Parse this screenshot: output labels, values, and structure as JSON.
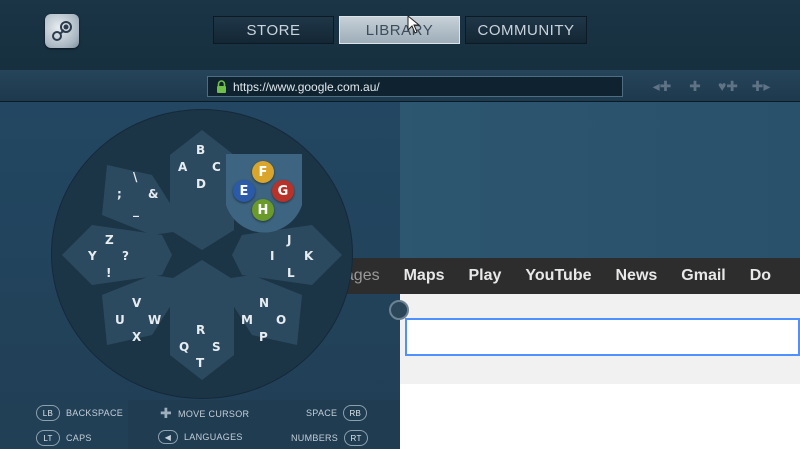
{
  "nav": {
    "tabs": [
      {
        "label": "STORE"
      },
      {
        "label": "LIBRARY",
        "active": true
      },
      {
        "label": "COMMUNITY"
      }
    ]
  },
  "url": {
    "value": "https://www.google.com.au/"
  },
  "google": {
    "items": [
      "nages",
      "Maps",
      "Play",
      "YouTube",
      "News",
      "Gmail",
      "Do"
    ]
  },
  "keyboard": {
    "groups": [
      [
        "B",
        "C",
        "A",
        "D"
      ],
      [
        "\\",
        "&",
        ";",
        "_"
      ],
      [
        "Z",
        "?",
        "Y",
        "!"
      ],
      [
        "V",
        "U",
        "W",
        "X"
      ],
      [
        "R",
        "Q",
        "S",
        "T"
      ],
      [
        "N",
        "M",
        "O",
        "P"
      ],
      [
        "J",
        "I",
        "K",
        "L"
      ]
    ],
    "buttons": {
      "top": "F",
      "left": "E",
      "right": "G",
      "bottom": "H"
    },
    "button_colors": {
      "F": "#d9a52a",
      "E": "#2a5aa8",
      "G": "#b8322a",
      "H": "#6a9a2a"
    }
  },
  "hints": {
    "backspace": {
      "pill": "LB",
      "label": "BACKSPACE"
    },
    "caps": {
      "pill": "LT",
      "label": "CAPS"
    },
    "move": {
      "label": "MOVE CURSOR"
    },
    "languages": {
      "label": "LANGUAGES"
    },
    "space": {
      "label": "SPACE",
      "pill": "RB"
    },
    "numbers": {
      "label": "NUMBERS",
      "pill": "RT"
    }
  }
}
